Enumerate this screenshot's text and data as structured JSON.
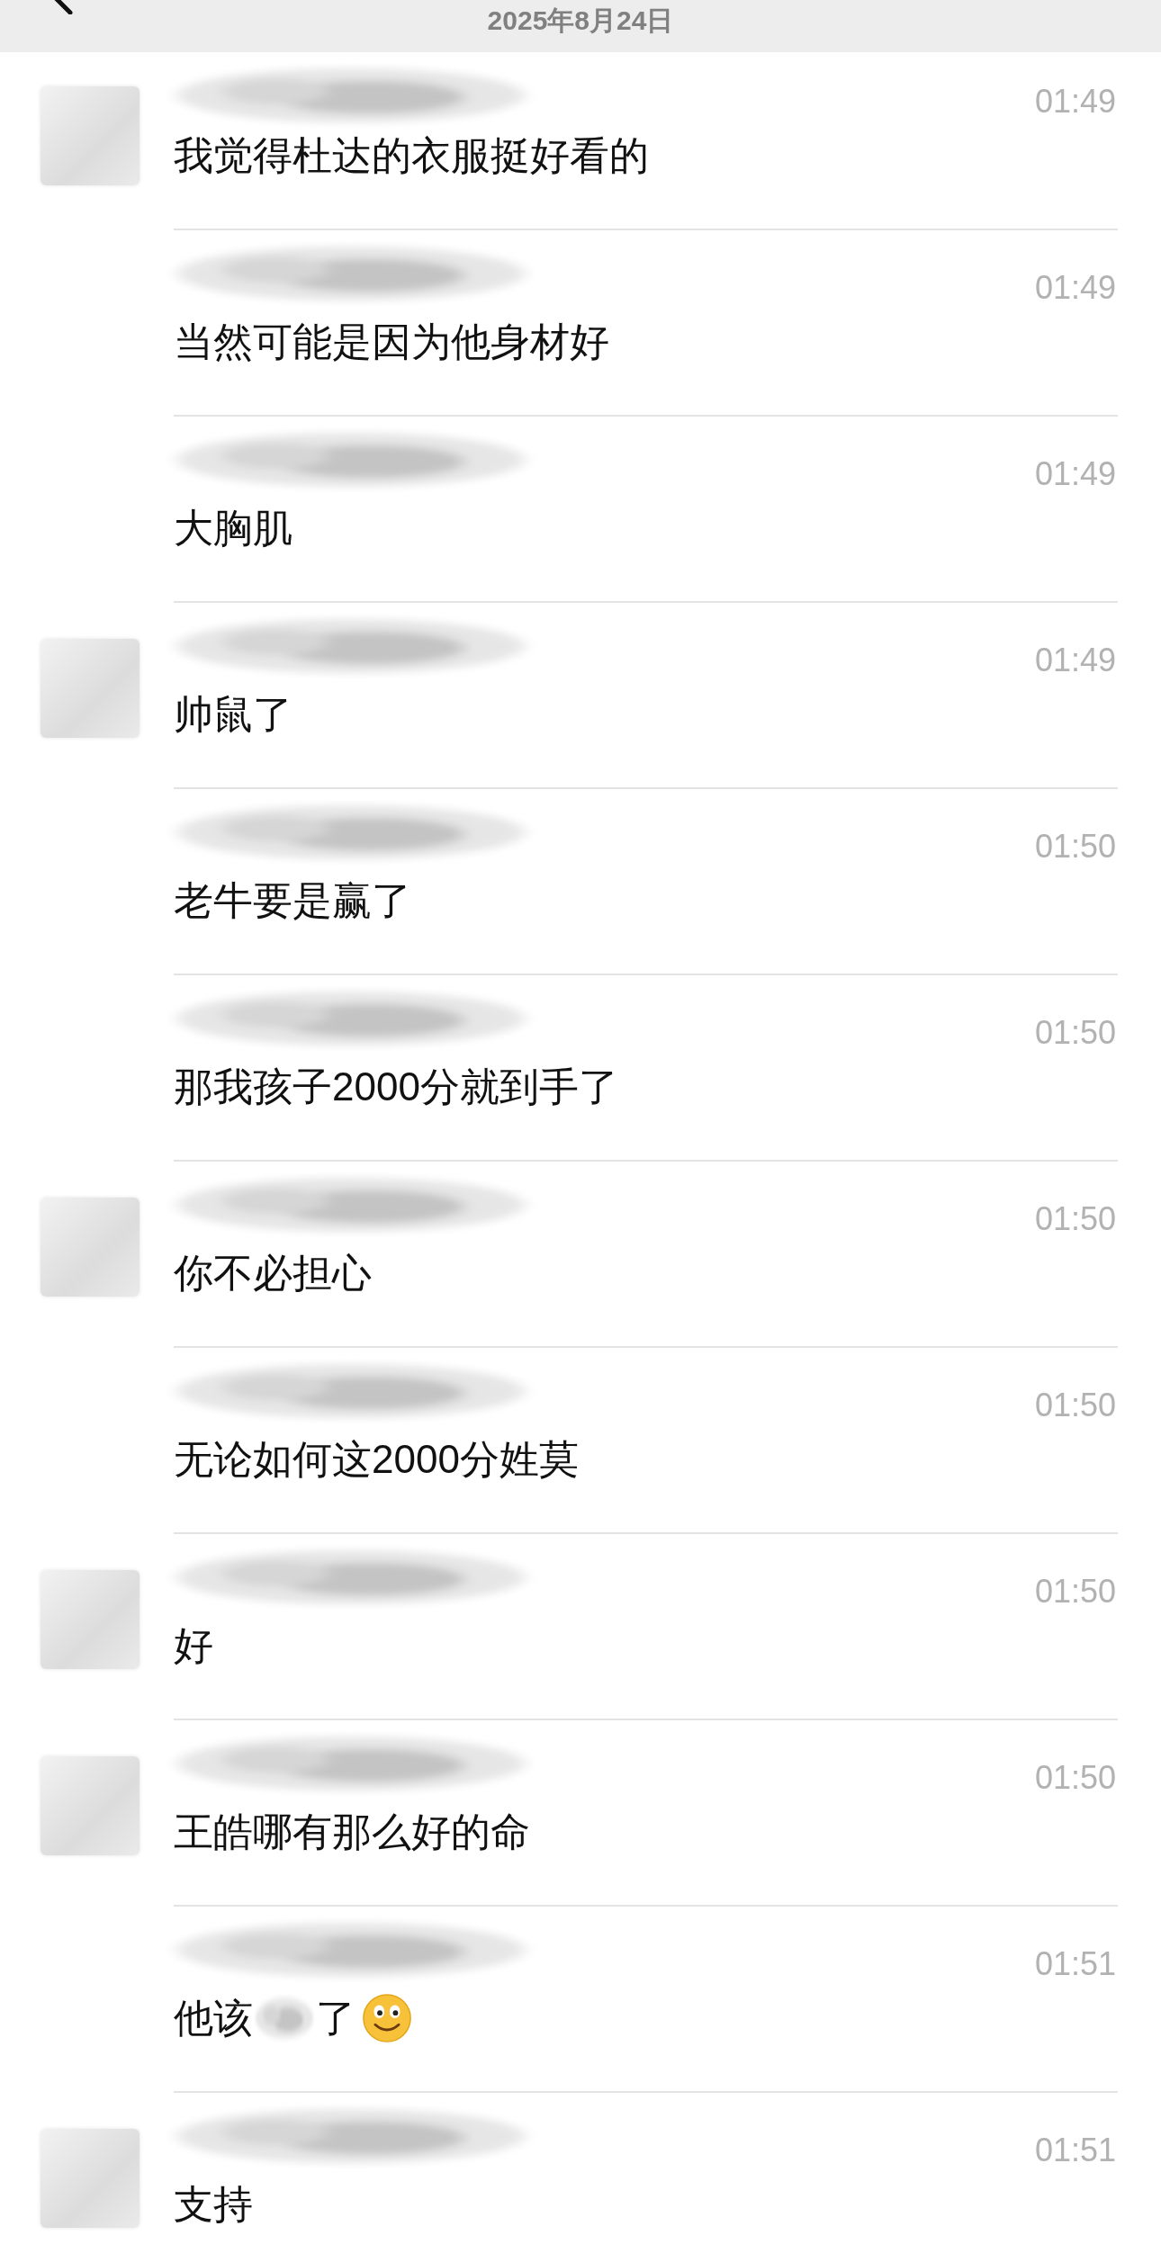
{
  "header": {
    "date": "2025年8月24日"
  },
  "messages": [
    {
      "avatar": true,
      "time": "01:49",
      "parts": [
        {
          "kind": "text",
          "text": "我觉得杜达的衣服挺好看的"
        }
      ]
    },
    {
      "avatar": false,
      "time": "01:49",
      "parts": [
        {
          "kind": "text",
          "text": "当然可能是因为他身材好"
        }
      ]
    },
    {
      "avatar": false,
      "time": "01:49",
      "parts": [
        {
          "kind": "text",
          "text": "大胸肌"
        }
      ]
    },
    {
      "avatar": true,
      "time": "01:49",
      "parts": [
        {
          "kind": "text",
          "text": "帅鼠了"
        }
      ]
    },
    {
      "avatar": false,
      "time": "01:50",
      "parts": [
        {
          "kind": "text",
          "text": "老牛要是赢了"
        }
      ]
    },
    {
      "avatar": false,
      "time": "01:50",
      "parts": [
        {
          "kind": "text",
          "text": "那我孩子2000分就到手了"
        }
      ]
    },
    {
      "avatar": true,
      "time": "01:50",
      "parts": [
        {
          "kind": "text",
          "text": "你不必担心"
        }
      ]
    },
    {
      "avatar": false,
      "time": "01:50",
      "parts": [
        {
          "kind": "text",
          "text": "无论如何这2000分姓莫"
        }
      ]
    },
    {
      "avatar": true,
      "time": "01:50",
      "parts": [
        {
          "kind": "text",
          "text": "好"
        }
      ]
    },
    {
      "avatar": true,
      "time": "01:50",
      "parts": [
        {
          "kind": "text",
          "text": "王皓哪有那么好的命"
        }
      ]
    },
    {
      "avatar": false,
      "time": "01:51",
      "parts": [
        {
          "kind": "text",
          "text": "他该"
        },
        {
          "kind": "redacted"
        },
        {
          "kind": "text",
          "text": "了"
        },
        {
          "kind": "emoji"
        }
      ]
    },
    {
      "avatar": true,
      "time": "01:51",
      "parts": [
        {
          "kind": "text",
          "text": "支持"
        }
      ]
    }
  ]
}
